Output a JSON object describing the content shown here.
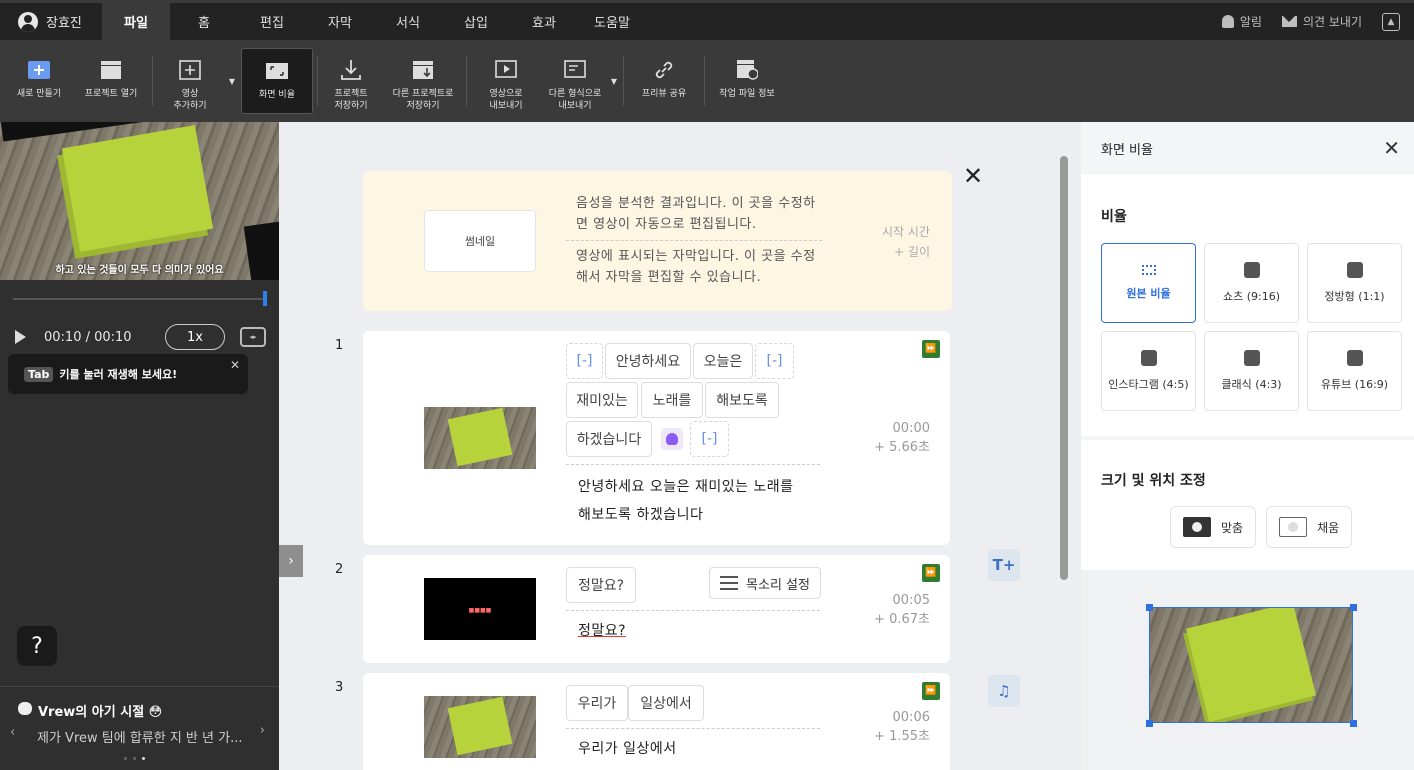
{
  "user": {
    "name": "장효진"
  },
  "menu": [
    "파일",
    "홈",
    "편집",
    "자막",
    "서식",
    "삽입",
    "효과",
    "도움말"
  ],
  "topright": {
    "alarm": "알림",
    "feedback": "의견 보내기"
  },
  "toolbar": {
    "new": "새로 만들기",
    "open": "프로젝트 열기",
    "add_video_1": "영상",
    "add_video_2": "추가하기",
    "aspect": "화면 비율",
    "save_1": "프로젝트",
    "save_2": "저장하기",
    "save_as_1": "다른 프로젝트로",
    "save_as_2": "저장하기",
    "export_video_1": "영상으로",
    "export_video_2": "내보내기",
    "export_other_1": "다른 형식으로",
    "export_other_2": "내보내기",
    "preview_share": "프리뷰 공유",
    "project_info": "작업 파일 정보"
  },
  "player": {
    "subtitle": "하고 있는 것들이 모두 다 의미가 있어요",
    "time": "00:10 / 00:10",
    "speed": "1x"
  },
  "tip": {
    "key": "Tab",
    "text": "키를 눌러 재생해 보세요!"
  },
  "help": "?",
  "news": {
    "title": "Vrew의 아기 시절 😳",
    "desc": "제가 Vrew 팀에 합류한 지 반 년 가..."
  },
  "guide": {
    "thumb": "썸네일",
    "line1": "음성을 분석한 결과입니다. 이 곳을 수정하면 영상이 자동으로 편집됩니다.",
    "line2": "영상에 표시되는 자막입니다. 이 곳을 수정해서 자막을 편집할 수 있습니다.",
    "start": "시작 시간",
    "length": "+ 길이"
  },
  "clips": [
    {
      "num": "1",
      "words": [
        "[-]",
        "안녕하세요",
        "오늘은",
        "[-]",
        "재미있는",
        "노래를",
        "해보도록",
        "하겠습니다",
        "[-]"
      ],
      "sent1": "안녕하세요 오늘은 재미있는 노래를",
      "sent2": "해보도록 하겠습니다",
      "time": "00:00",
      "dur": "+ 5.66초"
    },
    {
      "num": "2",
      "words": [
        "정말요?"
      ],
      "voice": "목소리 설정",
      "sent1": "정말요?",
      "time": "00:05",
      "dur": "+ 0.67초"
    },
    {
      "num": "3",
      "words": [
        "우리가",
        "일상에서"
      ],
      "sent1": "우리가 일상에서",
      "time": "00:06",
      "dur": "+ 1.55초"
    }
  ],
  "right": {
    "title": "화면 비율",
    "ratio_title": "비율",
    "ratios": [
      "원본 비율",
      "쇼츠 (9:16)",
      "정방형 (1:1)",
      "인스타그램 (4:5)",
      "클래식 (4:3)",
      "유튜브 (16:9)"
    ],
    "size_title": "크기 및 위치 조정",
    "fit": "맞춤",
    "fill": "채움"
  }
}
